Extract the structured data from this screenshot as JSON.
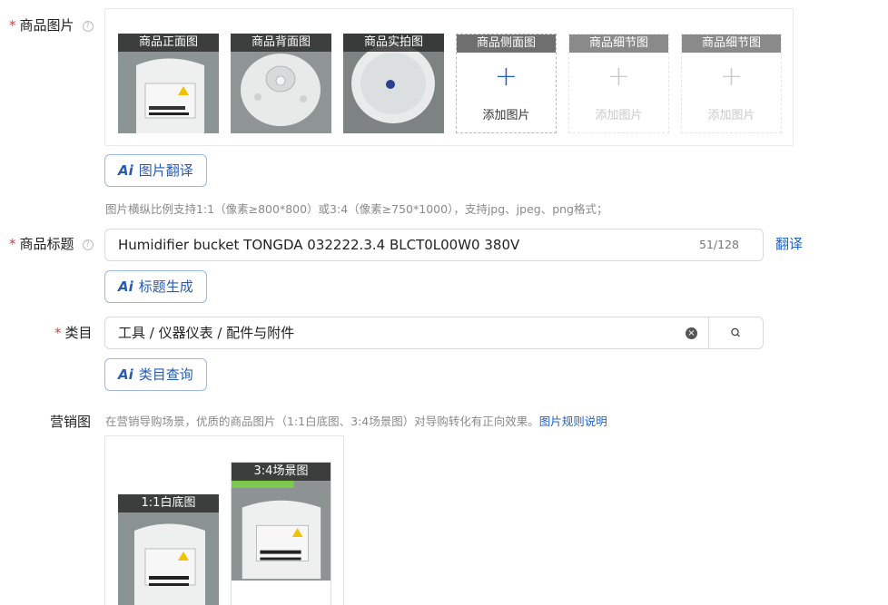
{
  "images": {
    "label": "商品图片",
    "help": "?",
    "tiles": [
      {
        "caption": "商品正面图"
      },
      {
        "caption": "商品背面图"
      },
      {
        "caption": "商品实拍图"
      },
      {
        "caption": "商品侧面图",
        "add_text": "添加图片"
      },
      {
        "caption": "商品细节图",
        "add_text": "添加图片"
      },
      {
        "caption": "商品细节图",
        "add_text": "添加图片"
      }
    ],
    "ai_button": "图片翻译",
    "hint": "图片横纵比例支持1:1（像素≥800*800）或3:4（像素≥750*1000），支持jpg、jpeg、png格式；"
  },
  "title_field": {
    "label": "商品标题",
    "help": "?",
    "value": "Humidifier bucket TONGDA 032222.3.4 BLCT0L00W0 380V",
    "counter": "51/128",
    "translate": "翻译",
    "ai_button": "标题生成"
  },
  "category": {
    "label": "类目",
    "value": "工具 / 仪器仪表 / 配件与附件",
    "ai_button": "类目查询"
  },
  "marketing": {
    "label": "营销图",
    "hint": "在营销导购场景，优质的商品图片（1:1白底图、3:4场景图）对导购转化有正向效果。",
    "link": "图片规则说明",
    "tile_1": "1:1白底图",
    "tile_2": "3:4场景图"
  },
  "common": {
    "required_mark": "*",
    "ai_mark": "Ai",
    "plus": "+",
    "clear": "×"
  }
}
